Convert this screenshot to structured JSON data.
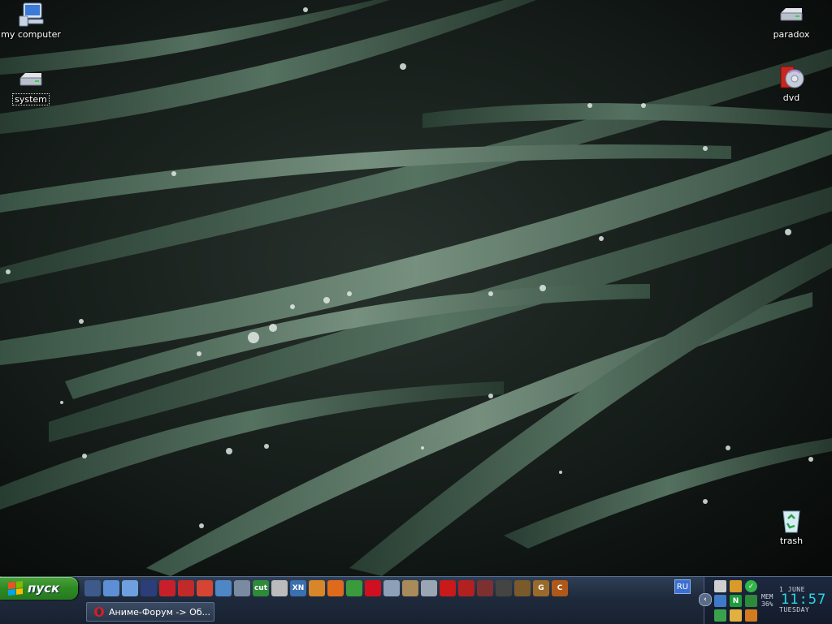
{
  "desktop": {
    "icons": [
      {
        "label": "my computer",
        "icon": "my-computer-icon"
      },
      {
        "label": "system",
        "icon": "drive-icon"
      },
      {
        "label": "paradox",
        "icon": "drive-icon"
      },
      {
        "label": "dvd",
        "icon": "dvd-icon"
      },
      {
        "label": "trash",
        "icon": "recycle-bin-icon"
      }
    ]
  },
  "taskbar": {
    "start_label": "пуск",
    "quick_launch": [
      {
        "icon": "file-manager-icon",
        "color": "#3d5a8a"
      },
      {
        "icon": "notepad-icon",
        "color": "#5c8fd6"
      },
      {
        "icon": "document-icon",
        "color": "#6ea0e0"
      },
      {
        "icon": "floppy-save-icon",
        "color": "#2c3e7a"
      },
      {
        "icon": "red-round-icon",
        "color": "#c8202a"
      },
      {
        "icon": "flash-icon",
        "color": "#c22a2a"
      },
      {
        "icon": "gmail-icon",
        "color": "#d64433"
      },
      {
        "icon": "network-icon",
        "color": "#4f86c6"
      },
      {
        "icon": "notes-icon",
        "color": "#7a8aa0"
      },
      {
        "icon": "cut-tool-icon",
        "color": "#2f8a3a",
        "text": "cut"
      },
      {
        "icon": "skull-icon",
        "color": "#bbbbbb"
      },
      {
        "icon": "xnview-icon",
        "color": "#3a6fb0",
        "text": "XN"
      },
      {
        "icon": "utility-icon",
        "color": "#d7862a"
      },
      {
        "icon": "firefox-icon",
        "color": "#e06a1c"
      },
      {
        "icon": "chrome-icon",
        "color": "#3a9a3c"
      },
      {
        "icon": "opera-icon",
        "color": "#d01020"
      },
      {
        "icon": "cloud-icon",
        "color": "#8da0b8"
      },
      {
        "icon": "scroll-icon",
        "color": "#a98a5a"
      },
      {
        "icon": "disc-icon",
        "color": "#9aa6b4"
      },
      {
        "icon": "red-face-icon",
        "color": "#c81a1a"
      },
      {
        "icon": "tool-icon",
        "color": "#b32020"
      },
      {
        "icon": "char-icon",
        "color": "#7d3030"
      },
      {
        "icon": "eye-icon",
        "color": "#444444"
      },
      {
        "icon": "game-icon",
        "color": "#7a5a2a"
      },
      {
        "icon": "gc-icon",
        "color": "#9a6a2a",
        "text": "G"
      },
      {
        "icon": "c-icon",
        "color": "#b05818",
        "text": "C"
      }
    ],
    "language": "RU",
    "tasks": [
      {
        "label": "Аниме-Форум -> Об...",
        "icon": "opera-icon"
      }
    ]
  },
  "tray": {
    "icons": [
      "skull-tray-icon",
      "butterfly-icon",
      "shield-check-icon",
      "network-tray-icon",
      "green-n-icon",
      "key-icon",
      "recycle-tray-icon",
      "folder-tray-icon",
      "utility-tray-icon"
    ],
    "mem_label": "MEM",
    "mem_value": "36%",
    "date": "1 JUNE",
    "time": "11:57",
    "day": "TUESDAY"
  }
}
